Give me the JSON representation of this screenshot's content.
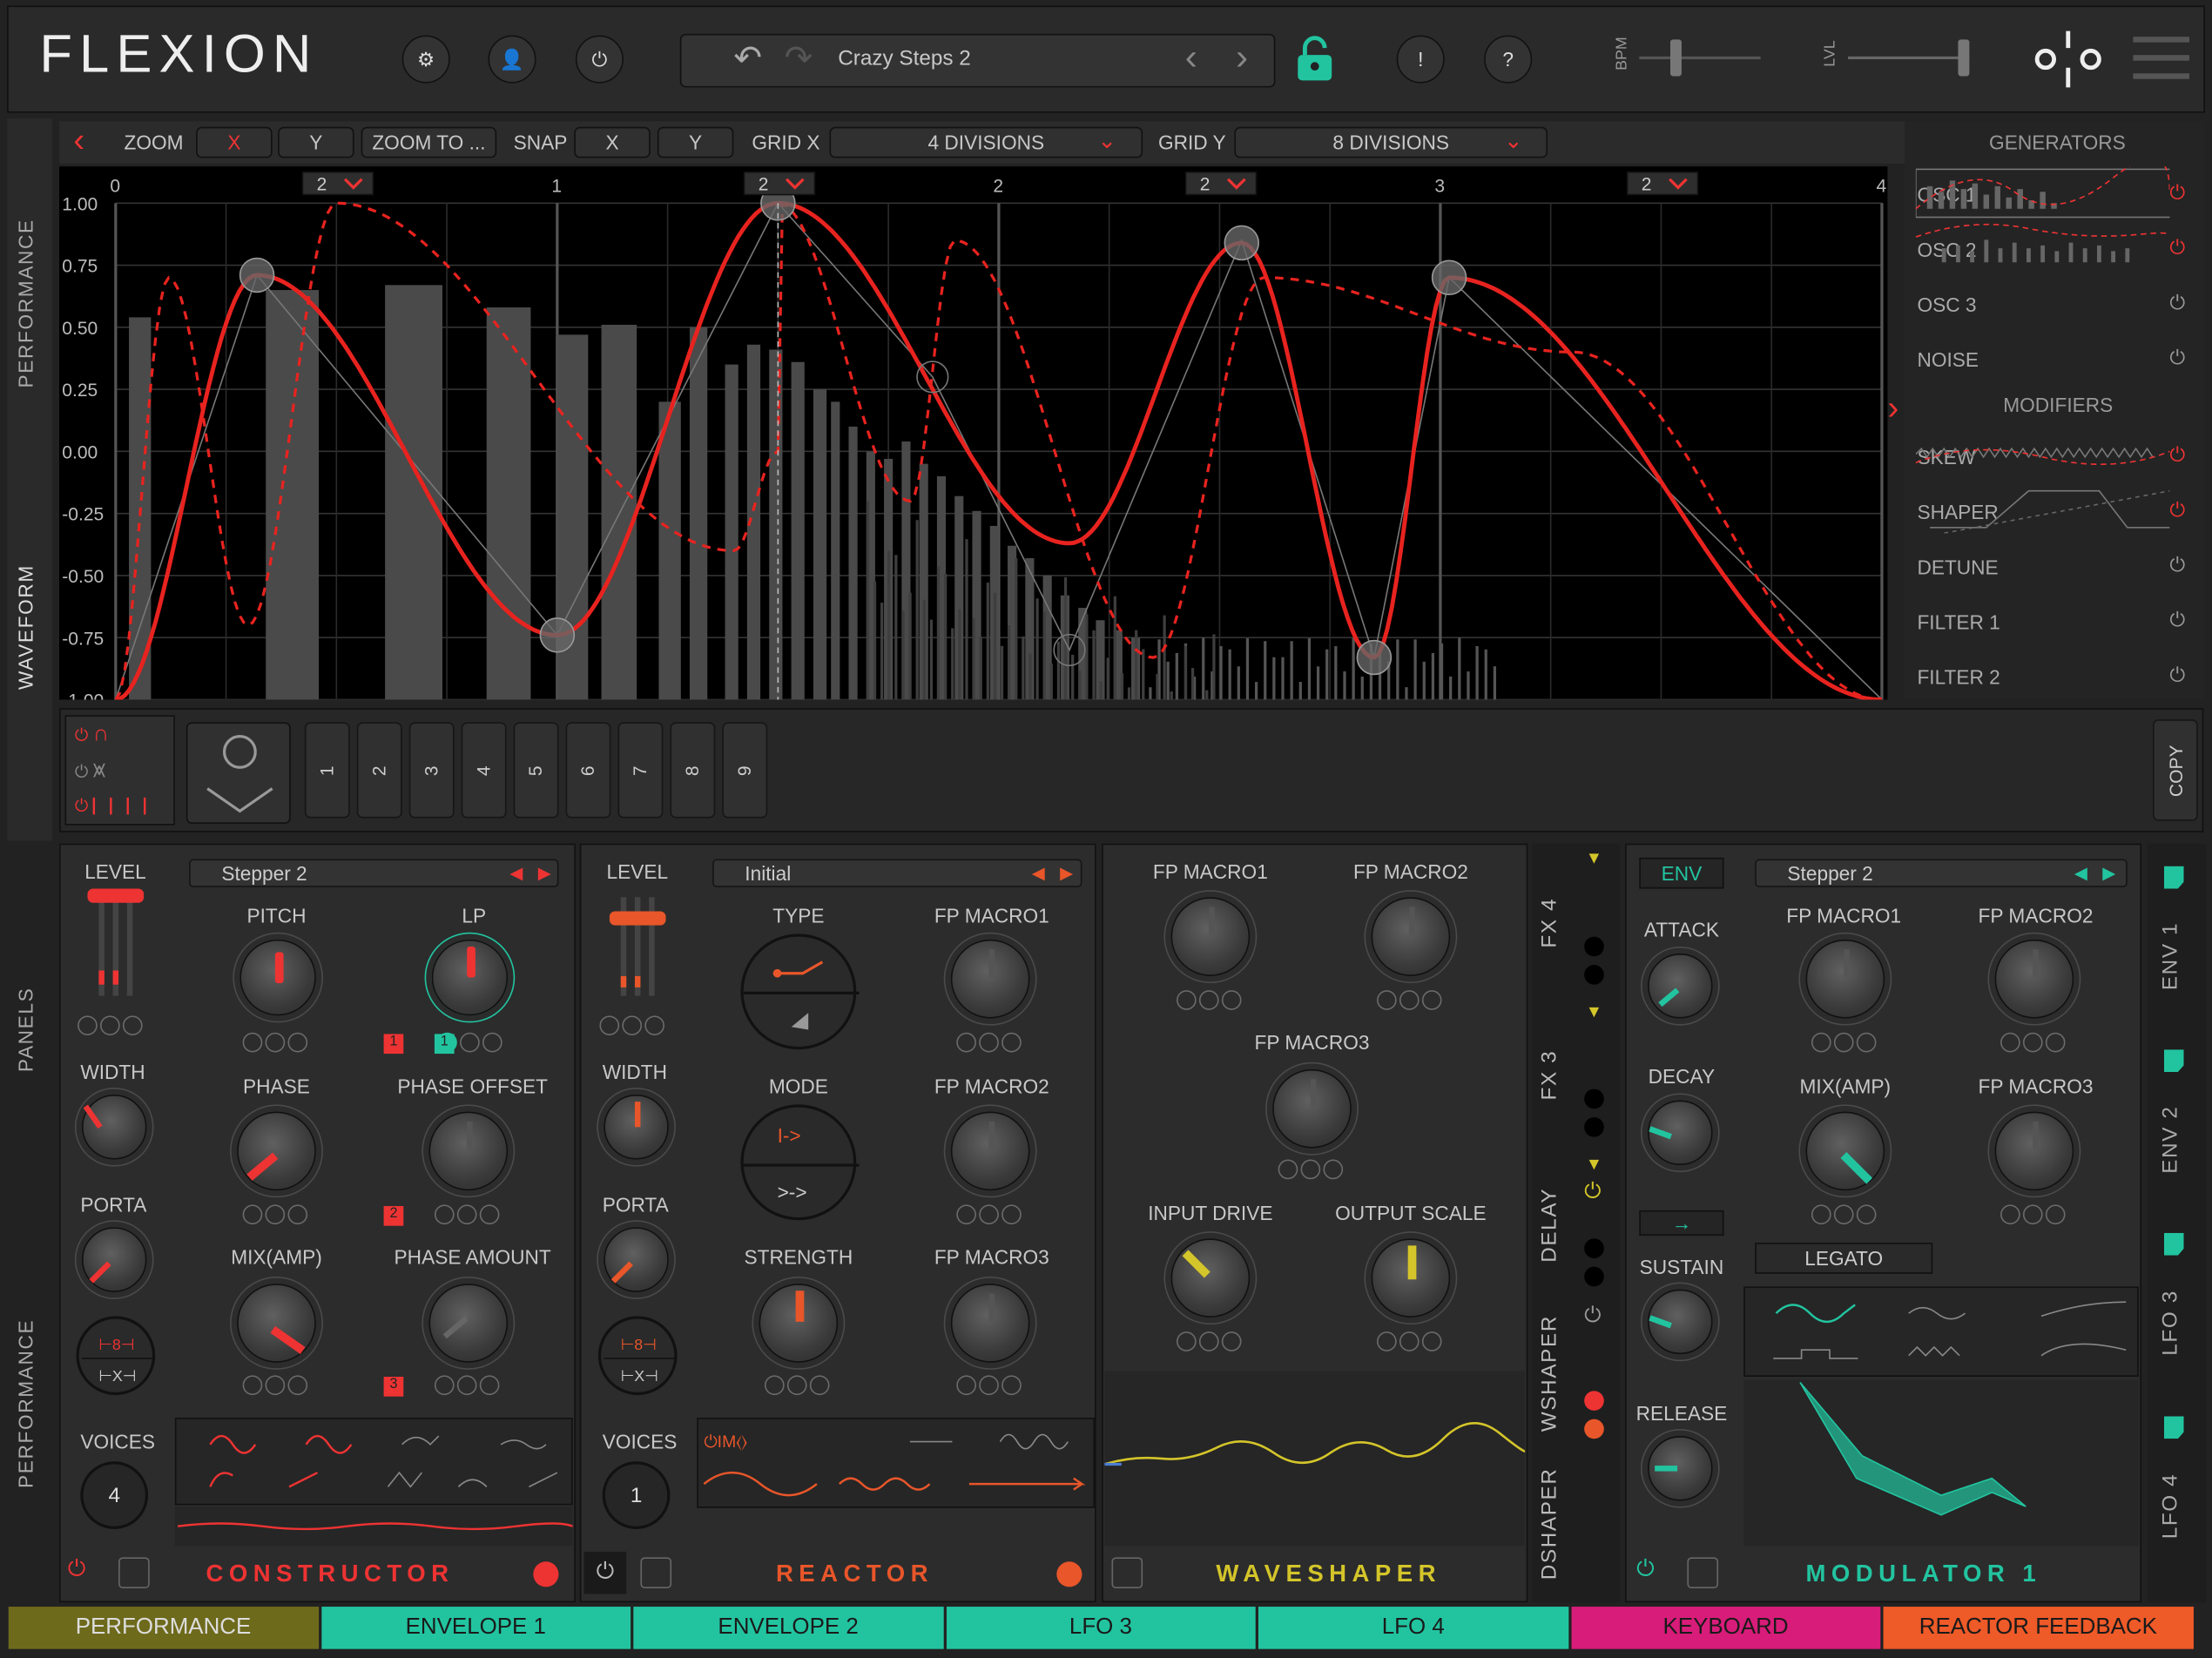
{
  "header": {
    "logo": "FLEXION",
    "preset_name": "Crazy Steps 2",
    "bpm_label": "BPM",
    "lvl_label": "LVL",
    "alert_icon": "!",
    "help_icon": "?"
  },
  "toolbar": {
    "zoom": "ZOOM",
    "zoom_x": "X",
    "zoom_y": "Y",
    "zoom_to": "ZOOM TO ...",
    "snap": "SNAP",
    "snap_x": "X",
    "snap_y": "Y",
    "grid_x": "GRID X",
    "grid_x_value": "4 DIVISIONS",
    "grid_y": "GRID Y",
    "grid_y_value": "8 DIVISIONS"
  },
  "graph": {
    "x_ticks": [
      "0",
      "1",
      "2",
      "3",
      "4"
    ],
    "y_ticks": [
      "1.00",
      "0.75",
      "0.50",
      "0.25",
      "0.00",
      "-0.25",
      "-0.50",
      "-0.75",
      "-1.00"
    ],
    "step_values": [
      "2",
      "2",
      "2",
      "2"
    ]
  },
  "side_tabs": {
    "performance": "PERFORMANCE",
    "waveform": "WAVEFORM",
    "panels": "PANELS",
    "performance2": "PERFORMANCE"
  },
  "generators": {
    "title": "GENERATORS",
    "items": [
      "OSC 1",
      "OSC 2",
      "OSC 3",
      "NOISE"
    ],
    "modifiers_title": "MODIFIERS",
    "modifiers": [
      "SKEW",
      "SHAPER",
      "DETUNE",
      "FILTER 1",
      "FILTER 2"
    ]
  },
  "slots": [
    "1",
    "2",
    "3",
    "4",
    "5",
    "6",
    "7",
    "8",
    "9"
  ],
  "copy": "COPY",
  "constructor": {
    "level": "LEVEL",
    "width": "WIDTH",
    "porta": "PORTA",
    "voices": "VOICES",
    "voices_value": "4",
    "preset": "Stepper 2",
    "pitch": "PITCH",
    "lp": "LP",
    "phase": "PHASE",
    "phase_offset": "PHASE OFFSET",
    "mix": "MIX(AMP)",
    "phase_amount": "PHASE AMOUNT",
    "badge1": "1",
    "badge1b": "1",
    "badge2": "2",
    "badge3": "3",
    "title": "CONSTRUCTOR"
  },
  "reactor": {
    "level": "LEVEL",
    "width": "WIDTH",
    "porta": "PORTA",
    "voices": "VOICES",
    "voices_value": "1",
    "preset": "Initial",
    "type": "TYPE",
    "mode": "MODE",
    "strength": "STRENGTH",
    "fp1": "FP MACRO1",
    "fp2": "FP MACRO2",
    "fp3": "FP MACRO3",
    "mode_a": "I->",
    "mode_b": ">->",
    "title": "REACTOR"
  },
  "waveshaper": {
    "fp1": "FP MACRO1",
    "fp2": "FP MACRO2",
    "fp3": "FP MACRO3",
    "input_drive": "INPUT DRIVE",
    "output_scale": "OUTPUT SCALE",
    "title": "WAVESHAPER"
  },
  "fx_tabs": [
    "FX 4",
    "FX 3",
    "DELAY",
    "WSHAPER",
    "DSHAPER"
  ],
  "modulator": {
    "env": "ENV",
    "preset": "Stepper 2",
    "attack": "ATTACK",
    "decay": "DECAY",
    "sustain": "SUSTAIN",
    "release": "RELEASE",
    "fp1": "FP MACRO1",
    "fp2": "FP MACRO2",
    "mix": "MIX(AMP)",
    "fp3": "FP MACRO3",
    "legato": "LEGATO",
    "title": "MODULATOR 1"
  },
  "mod_tabs": [
    "ENV 1",
    "ENV 2",
    "LFO 3",
    "LFO 4"
  ],
  "bottom_tabs": [
    {
      "label": "PERFORMANCE",
      "color": "#6e6a1c"
    },
    {
      "label": "ENVELOPE 1",
      "color": "#22c4a0"
    },
    {
      "label": "ENVELOPE 2",
      "color": "#22c4a0"
    },
    {
      "label": "LFO 3",
      "color": "#22c4a0"
    },
    {
      "label": "LFO 4",
      "color": "#22c4a0"
    },
    {
      "label": "KEYBOARD",
      "color": "#d81c79"
    },
    {
      "label": "REACTOR FEEDBACK",
      "color": "#ee5a28"
    }
  ],
  "colors": {
    "accent_red": "#e8231f",
    "teal": "#22c4a0",
    "yellow": "#d4c52a",
    "orange": "#ee5a28"
  }
}
